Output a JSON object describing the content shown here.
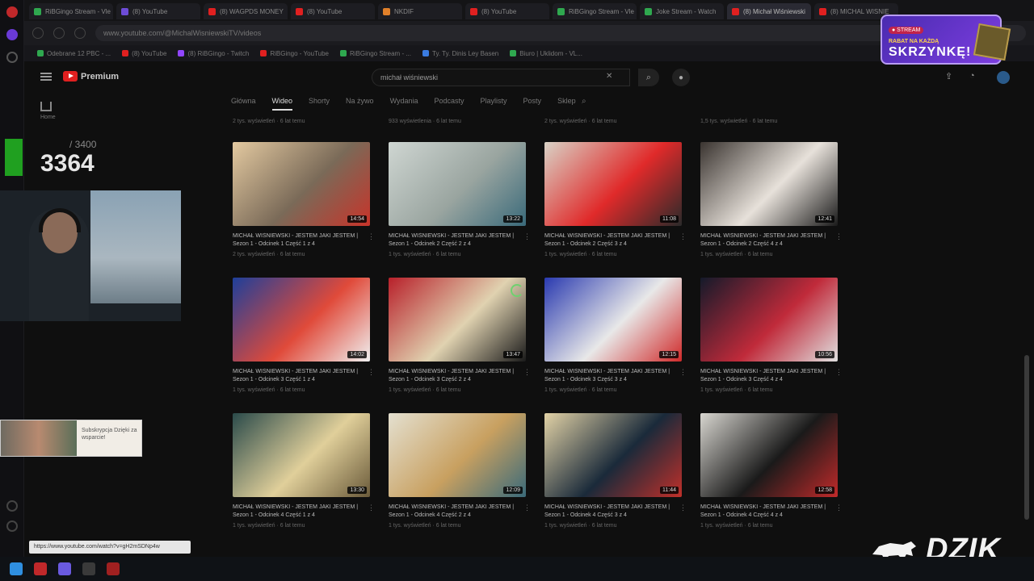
{
  "browser": {
    "tabs": [
      {
        "title": "RiBGingo Stream - Vle",
        "color": "#2fa84f",
        "active": false
      },
      {
        "title": "(8) YouTube",
        "color": "#6d4cd6",
        "active": false
      },
      {
        "title": "(8) WAGPDS MONEY",
        "color": "#e02020",
        "active": false
      },
      {
        "title": "(8) YouTube",
        "color": "#e02020",
        "active": false
      },
      {
        "title": "NKDIF",
        "color": "#e0802a",
        "active": false
      },
      {
        "title": "(8) YouTube",
        "color": "#e02020",
        "active": false
      },
      {
        "title": "RiBGingo Stream - Vle",
        "color": "#2fa84f",
        "active": false
      },
      {
        "title": "Joke Stream - Watch",
        "color": "#2fa84f",
        "active": false
      },
      {
        "title": "(8) Michał Wiśniewski",
        "color": "#e02020",
        "active": true
      },
      {
        "title": "(8) MICHAL WISNIE",
        "color": "#e02020",
        "active": false
      }
    ],
    "url": "www.youtube.com/@MichalWisniewskiTV/videos",
    "bookmarks": [
      {
        "label": "Odebrane 12 PBC - ...",
        "color": "#2fa84f"
      },
      {
        "label": "(8) YouTube",
        "color": "#e02020"
      },
      {
        "label": "(8) RiBGingo - Twitch",
        "color": "#9146ff"
      },
      {
        "label": "RiBGingo - YouTube",
        "color": "#e02020"
      },
      {
        "label": "RiBGingo Stream - ...",
        "color": "#2fa84f"
      },
      {
        "label": "Ty. Ty. Dinis Ley Basen",
        "color": "#3a7be0"
      },
      {
        "label": "Biuro | Uklidom - VL...",
        "color": "#2fa84f"
      }
    ]
  },
  "youtube": {
    "logo_word": "Premium",
    "search_query": "michał wiśniewski",
    "search_clear": "✕",
    "search_icon": "search-icon",
    "home_label": "Home",
    "channel_tabs": [
      {
        "label": "Główna",
        "active": false
      },
      {
        "label": "Wideo",
        "active": true
      },
      {
        "label": "Shorty",
        "active": false
      },
      {
        "label": "Na żywo",
        "active": false
      },
      {
        "label": "Wydania",
        "active": false
      },
      {
        "label": "Podcasty",
        "active": false
      },
      {
        "label": "Playlisty",
        "active": false
      },
      {
        "label": "Posty",
        "active": false
      },
      {
        "label": "Sklep",
        "active": false
      }
    ],
    "partial_row_meta": [
      "2 tys. wyświetleń · 6 lat temu",
      "933 wyświetlenia · 6 lat temu",
      "2 tys. wyświetleń · 6 lat temu",
      "1,5 tys. wyświetleń · 6 lat temu"
    ],
    "videos": [
      {
        "title": "MICHAŁ WIŚNIEWSKI - JESTEM JAKI JESTEM | Sezon 1 - Odcinek 1 Część 1 z 4",
        "meta": "2 tys. wyświetleń · 6 lat temu",
        "duration": "14:54",
        "thumb": [
          "#e3c9a0",
          "#7a6a58",
          "#c8342a"
        ]
      },
      {
        "title": "MICHAŁ WIŚNIEWSKI - JESTEM JAKI JESTEM | Sezon 1 - Odcinek 2 Część 2 z 4",
        "meta": "1 tys. wyświetleń · 6 lat temu",
        "duration": "13:22",
        "thumb": [
          "#cfd6d2",
          "#9aa5a0",
          "#3a6a7a"
        ]
      },
      {
        "title": "MICHAŁ WIŚNIEWSKI - JESTEM JAKI JESTEM | Sezon 1 - Odcinek 2 Część 3 z 4",
        "meta": "1 tys. wyświetleń · 6 lat temu",
        "duration": "11:08",
        "thumb": [
          "#d9d2c6",
          "#e02a2a",
          "#2a2a2a"
        ]
      },
      {
        "title": "MICHAŁ WIŚNIEWSKI - JESTEM JAKI JESTEM | Sezon 1 - Odcinek 2 Część 4 z 4",
        "meta": "1 tys. wyświetleń · 6 lat temu",
        "duration": "12:41",
        "thumb": [
          "#3a3430",
          "#e7e1da",
          "#1a1a1a"
        ]
      },
      {
        "title": "MICHAŁ WIŚNIEWSKI - JESTEM JAKI JESTEM | Sezon 1 - Odcinek 3 Część 1 z 4",
        "meta": "1 tys. wyświetleń · 6 lat temu",
        "duration": "14:02",
        "thumb": [
          "#1e3f9a",
          "#e04a3a",
          "#f0f0f0"
        ]
      },
      {
        "title": "MICHAŁ WIŚNIEWSKI - JESTEM JAKI JESTEM | Sezon 1 - Odcinek 3 Część 2 z 4",
        "meta": "1 tys. wyświetleń · 6 lat temu",
        "duration": "13:47",
        "thumb": [
          "#b8202a",
          "#e0d2b0",
          "#1a1a1a"
        ]
      },
      {
        "title": "MICHAŁ WIŚNIEWSKI - JESTEM JAKI JESTEM | Sezon 1 - Odcinek 3 Część 3 z 4",
        "meta": "1 tys. wyświetleń · 6 lat temu",
        "duration": "12:15",
        "thumb": [
          "#2a3ab0",
          "#e8e8e8",
          "#d02a2a"
        ]
      },
      {
        "title": "MICHAŁ WIŚNIEWSKI - JESTEM JAKI JESTEM | Sezon 1 - Odcinek 3 Część 4 z 4",
        "meta": "1 tys. wyświetleń · 6 lat temu",
        "duration": "10:56",
        "thumb": [
          "#141a2a",
          "#c02a3a",
          "#e0e0e0"
        ]
      },
      {
        "title": "MICHAŁ WIŚNIEWSKI - JESTEM JAKI JESTEM | Sezon 1 - Odcinek 4 Część 1 z 4",
        "meta": "1 tys. wyświetleń · 6 lat temu",
        "duration": "13:30",
        "thumb": [
          "#2a4a4a",
          "#e0cf9a",
          "#6a5a3a"
        ]
      },
      {
        "title": "MICHAŁ WIŚNIEWSKI - JESTEM JAKI JESTEM | Sezon 1 - Odcinek 4 Część 2 z 4",
        "meta": "1 tys. wyświetleń · 6 lat temu",
        "duration": "12:09",
        "thumb": [
          "#e4e0d0",
          "#c8a060",
          "#3a6a7a"
        ]
      },
      {
        "title": "MICHAŁ WIŚNIEWSKI - JESTEM JAKI JESTEM | Sezon 1 - Odcinek 4 Część 3 z 4",
        "meta": "1 tys. wyświetleń · 6 lat temu",
        "duration": "11:44",
        "thumb": [
          "#e2d2a6",
          "#1a2a3a",
          "#c0302a"
        ]
      },
      {
        "title": "MICHAŁ WIŚNIEWSKI - JESTEM JAKI JESTEM | Sezon 1 - Odcinek 4 Część 4 z 4",
        "meta": "1 tys. wyświetleń · 6 lat temu",
        "duration": "12:58",
        "thumb": [
          "#d8d6d0",
          "#1a1a1a",
          "#c02a2a"
        ]
      }
    ],
    "status_url": "https://www.youtube.com/watch?v=gH2mSDNp4w"
  },
  "overlay": {
    "counter_goal": "/ 3400",
    "counter_value": "3364",
    "alert_text": "Subskrypcja Dzięki za wsparcie!",
    "promo_tag": "● STREAM",
    "promo_line1": "RABAT NA KAŻDĄ",
    "promo_line2": "SKRZYNKĘ!",
    "brand": "DZIK"
  }
}
